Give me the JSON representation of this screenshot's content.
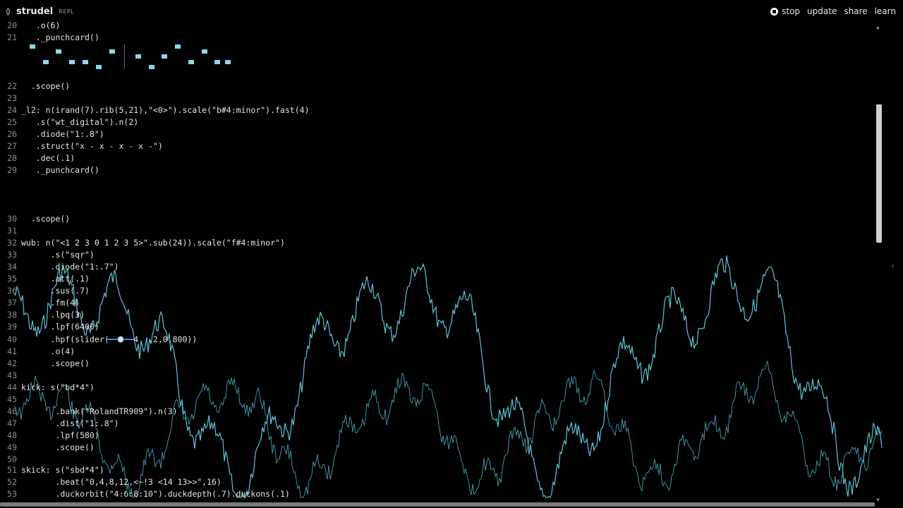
{
  "app": {
    "name": "strudel",
    "sub": "REPL",
    "nav": {
      "stop": "stop",
      "update": "update",
      "share": "share",
      "learn": "learn"
    }
  },
  "colors": {
    "accent": "#5fc7d8",
    "background": "#000000",
    "text": "#e6e6e6"
  },
  "icons": {
    "brand": "strudel-logo-icon",
    "stop": "stop-icon",
    "collapse": "chevron-left-icon"
  },
  "lines": [
    {
      "n": "20",
      "t": "   .o(6)"
    },
    {
      "n": "21",
      "t": "   ._punchcard()"
    },
    {
      "n": "22",
      "t": "  .scope()"
    },
    {
      "n": "23",
      "t": ""
    },
    {
      "n": "24",
      "t": "_l2: n(irand(7).rib(5,21),\"<0>\").scale(\"b#4:minor\").fast(4)"
    },
    {
      "n": "25",
      "t": "   .s(\"wt_digital\").n(2)"
    },
    {
      "n": "26",
      "t": "   .diode(\"1:.8\")"
    },
    {
      "n": "27",
      "t": "   .struct(\"x - x - x - x -\")"
    },
    {
      "n": "28",
      "t": "   .dec(.1)"
    },
    {
      "n": "29",
      "t": "   ._punchcard()"
    },
    {
      "n": "30",
      "t": "  .scope()"
    },
    {
      "n": "31",
      "t": ""
    },
    {
      "n": "32",
      "t": "wub: n(\"<1 2 3 0 1 2 3 5>\".sub(24)).scale(\"f#4:minor\")"
    },
    {
      "n": "33",
      "t": "      .s(\"sqr\")"
    },
    {
      "n": "34",
      "t": "      .diode(\"1:.7\")"
    },
    {
      "n": "35",
      "t": "      .att(.1)"
    },
    {
      "n": "36",
      "t": "      .sus(.7)"
    },
    {
      "n": "37",
      "t": "      .fm(4)"
    },
    {
      "n": "38",
      "t": "      .lpq(3)"
    },
    {
      "n": "39",
      "t": "      .lpf(6400)"
    },
    {
      "n": "40",
      "t": "      .hpf(slider(     4  .2,0,800))"
    },
    {
      "n": "41",
      "t": "      .o(4)"
    },
    {
      "n": "42",
      "t": "      .scope()"
    },
    {
      "n": "43",
      "t": ""
    },
    {
      "n": "44",
      "t": "kick: s(\"bd*4\")"
    },
    {
      "n": "45",
      "t": ""
    },
    {
      "n": "46",
      "t": "       .bank(\"RolandTR909\").n(3)"
    },
    {
      "n": "47",
      "t": "       .dist(\"1:.8\")"
    },
    {
      "n": "48",
      "t": "       .lpf(580)"
    },
    {
      "n": "49",
      "t": "       .scope()"
    },
    {
      "n": "50",
      "t": ""
    },
    {
      "n": "51",
      "t": "skick: s(\"sbd*4\")"
    },
    {
      "n": "52",
      "t": "       .beat(\"0,4,8,12,<~!3 <14 13>>\",16)"
    },
    {
      "n": "53",
      "t": "       .duckorbit(\"4:6:8:10\").duckdepth(.7).duckons(.1)"
    }
  ]
}
